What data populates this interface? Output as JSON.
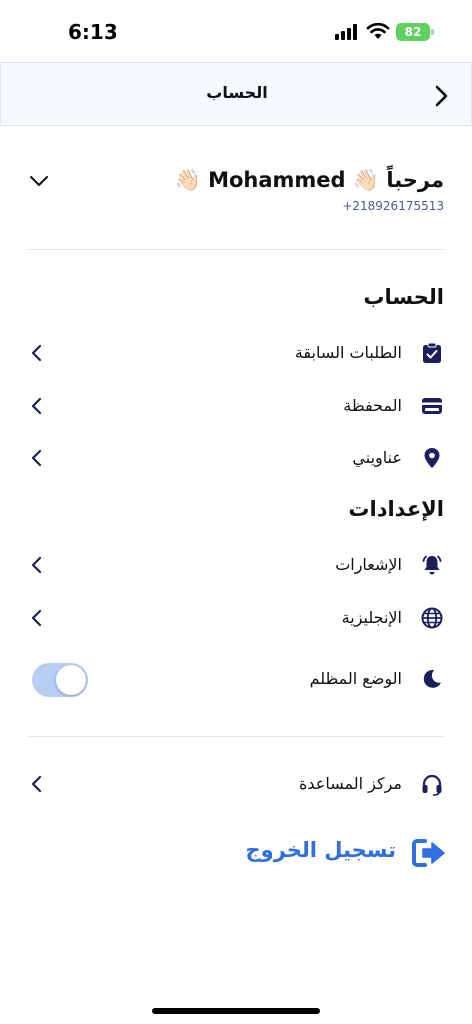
{
  "status_bar": {
    "time": "6:13",
    "battery": "82"
  },
  "header": {
    "title": "الحساب",
    "back_icon": "chevron-right-icon"
  },
  "profile": {
    "greeting": "مرحباً 👋🏻 Mohammed 👋🏻",
    "phone": "+218926175513",
    "expand_icon": "chevron-down-icon"
  },
  "account_section": {
    "title": "الحساب",
    "items": [
      {
        "label": "الطلبات السابقة",
        "icon": "clipboard-check-icon"
      },
      {
        "label": "المحفظة",
        "icon": "wallet-icon"
      },
      {
        "label": "عناويني",
        "icon": "map-pin-icon"
      }
    ]
  },
  "settings_section": {
    "title": "الإعدادات",
    "items": [
      {
        "label": "الإشعارات",
        "icon": "bell-icon"
      },
      {
        "label": "الإنجليزية",
        "icon": "globe-icon"
      },
      {
        "label": "الوضع المظلم",
        "icon": "moon-icon",
        "toggle_on": true
      }
    ]
  },
  "support": {
    "label": "مركز المساعدة",
    "icon": "headphones-icon"
  },
  "logout": {
    "label": "تسجيل الخروج",
    "icon": "logout-icon"
  },
  "colors": {
    "primary": "#2f6fe0",
    "navy_icon": "#1b1f5e",
    "toggle_track": "#b7cdf2",
    "battery": "#5fd15f"
  }
}
